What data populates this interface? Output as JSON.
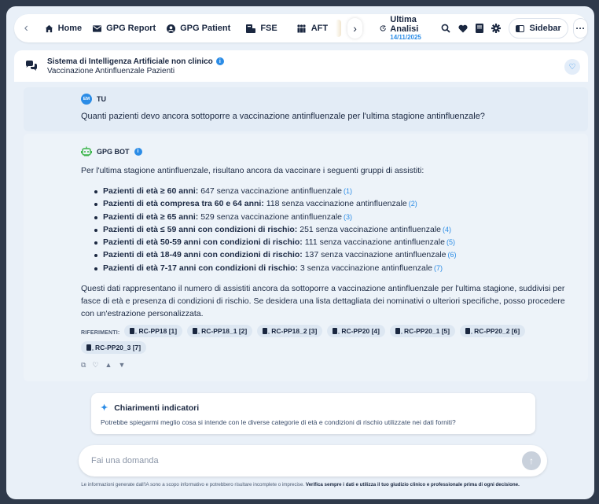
{
  "nav": {
    "home": "Home",
    "gpg_report": "GPG Report",
    "gpg_patient": "GPG Patient",
    "fse": "FSE",
    "aft": "AFT",
    "ultima_title": "Ultima Analisi",
    "ultima_date": "14/11/2025",
    "sidebar": "Sidebar",
    "more": "···"
  },
  "header": {
    "title": "Sistema di Intelligenza Artificiale non clinico",
    "subtitle": "Vaccinazione Antinfluenzale Pazienti"
  },
  "user": {
    "initials": "EM",
    "label": "TU",
    "message": "Quanti pazienti devo ancora sottoporre a vaccinazione antinfluenzale per l'ultima stagione antinfluenzale?"
  },
  "bot": {
    "label": "GPG BOT",
    "intro": "Per l'ultima stagione antinfluenzale, risultano ancora da vaccinare i seguenti gruppi di assistiti:",
    "groups": [
      {
        "title": "Pazienti di età ≥ 60 anni:",
        "text": " 647 senza vaccinazione antinfluenzale",
        "ref": "(1)"
      },
      {
        "title": "Pazienti di età compresa tra 60 e 64 anni:",
        "text": " 118 senza vaccinazione antinfluenzale",
        "ref": "(2)"
      },
      {
        "title": "Pazienti di età ≥ 65 anni:",
        "text": " 529 senza vaccinazione antinfluenzale",
        "ref": "(3)"
      },
      {
        "title": "Pazienti di età ≤ 59 anni con condizioni di rischio:",
        "text": " 251 senza vaccinazione antinfluenzale",
        "ref": "(4)"
      },
      {
        "title": "Pazienti di età 50-59 anni con condizioni di rischio:",
        "text": " 111 senza vaccinazione antinfluenzale",
        "ref": "(5)"
      },
      {
        "title": "Pazienti di età 18-49 anni con condizioni di rischio:",
        "text": " 137 senza vaccinazione antinfluenzale",
        "ref": "(6)"
      },
      {
        "title": "Pazienti di età 7-17 anni con condizioni di rischio:",
        "text": " 3 senza vaccinazione antinfluenzale",
        "ref": "(7)"
      }
    ],
    "summary": "Questi dati rappresentano il numero di assistiti ancora da sottoporre a vaccinazione antinfluenzale per l'ultima stagione, suddivisi per fasce di età e presenza di condizioni di rischio. Se desidera una lista dettagliata dei nominativi o ulteriori specifiche, posso procedere con un'estrazione personalizzata.",
    "refs_label": "RIFERIMENTI:",
    "refs": [
      "RC-PP18 [1]",
      "RC-PP18_1 [2]",
      "RC-PP18_2 [3]",
      "RC-PP20 [4]",
      "RC-PP20_1 [5]",
      "RC-PP20_2 [6]",
      "RC-PP20_3 [7]"
    ]
  },
  "suggestion": {
    "title": "Chiarimenti indicatori",
    "text": "Potrebbe spiegarmi meglio cosa si intende con le diverse categorie di età e condizioni di rischio utilizzate nei dati forniti?"
  },
  "input": {
    "placeholder": "Fai una domanda"
  },
  "disclaimer": {
    "text": "Le informazioni generate dall'IA sono a scopo informativo e potrebbero risultare incomplete o imprecise. ",
    "bold": "Verifica sempre i dati e utilizza il tuo giudizio clinico e professionale prima di ogni decisione."
  },
  "colors": {
    "accent": "#2b8ce6",
    "bot_icon": "#3bb54a",
    "background": "#e9f0f8"
  }
}
